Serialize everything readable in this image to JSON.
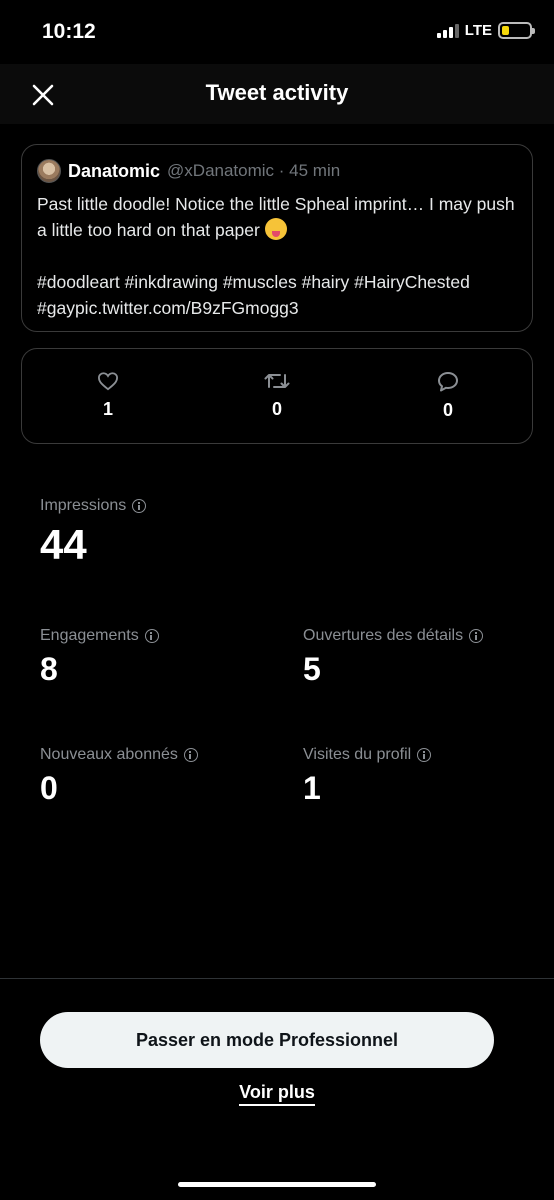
{
  "status_bar": {
    "time": "10:12",
    "network": "LTE",
    "battery_level": 0.25,
    "battery_color": "#f5d70a"
  },
  "header": {
    "title": "Tweet activity",
    "close_icon": "close-icon"
  },
  "tweet": {
    "author_name": "Danatomic",
    "author_meta": "@xDanatomic · 45 min",
    "text_line1": "Past little doodle! Notice the little Spheal imprint… I may push a little too hard on that paper ",
    "emoji": "squinting-face-with-tongue",
    "text_line2": "#doodleart #inkdrawing #muscles #hairy #HairyChested #gaypic.twitter.com/B9zFGmogg3"
  },
  "engagement_counts": {
    "likes": "1",
    "retweets": "0",
    "replies": "0"
  },
  "metrics": {
    "impressions": {
      "label": "Impressions",
      "value": "44"
    },
    "engagements": {
      "label": "Engagements",
      "value": "8"
    },
    "detail_expands": {
      "label": "Ouvertures des détails",
      "value": "5"
    },
    "new_followers": {
      "label": "Nouveaux abonnés",
      "value": "0"
    },
    "profile_visits": {
      "label": "Visites du profil",
      "value": "1"
    }
  },
  "footer": {
    "pro_button": "Passer en mode Professionnel",
    "more_link": "Voir plus"
  },
  "colors": {
    "background": "#000000",
    "muted_text": "#8b8f94",
    "button_bg": "#eff3f4"
  }
}
